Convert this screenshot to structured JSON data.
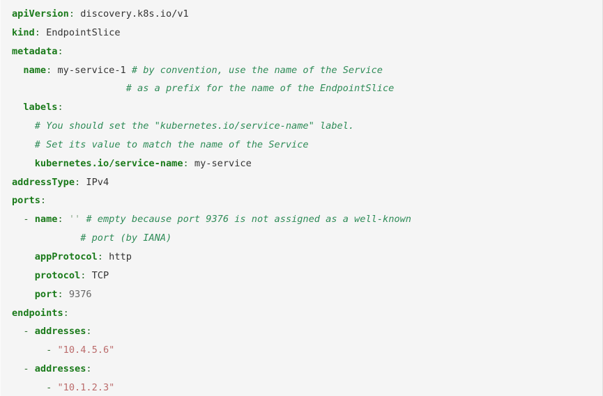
{
  "block": {
    "language": "yaml",
    "kind": "kubernetes-manifest",
    "background_color": "#f5f5f5",
    "border_color": "#e0e0e0",
    "colors": {
      "key": "#1a7a1a",
      "value": "#333333",
      "comment": "#2e8b57",
      "string": "#bb6b6b",
      "number": "#666666",
      "punctuation": "#2f6f2f"
    }
  },
  "code": {
    "lines": [
      {
        "id": "line-api-version",
        "indent": "",
        "tokens": [
          {
            "t": "k",
            "x": "apiVersion"
          },
          {
            "t": "p",
            "x": ":"
          },
          {
            "t": "v",
            "x": " discovery.k8s.io/v1"
          }
        ]
      },
      {
        "id": "line-kind",
        "indent": "",
        "tokens": [
          {
            "t": "k",
            "x": "kind"
          },
          {
            "t": "p",
            "x": ":"
          },
          {
            "t": "v",
            "x": " EndpointSlice"
          }
        ]
      },
      {
        "id": "line-metadata",
        "indent": "",
        "tokens": [
          {
            "t": "k",
            "x": "metadata"
          },
          {
            "t": "p",
            "x": ":"
          }
        ]
      },
      {
        "id": "line-metadata-name",
        "indent": "  ",
        "tokens": [
          {
            "t": "k",
            "x": "name"
          },
          {
            "t": "p",
            "x": ":"
          },
          {
            "t": "v",
            "x": " my-service-1 "
          },
          {
            "t": "c",
            "x": "# by convention, use the name of the Service"
          }
        ]
      },
      {
        "id": "line-metadata-name-comment-2",
        "indent": "                    ",
        "tokens": [
          {
            "t": "c",
            "x": "# as a prefix for the name of the EndpointSlice"
          }
        ]
      },
      {
        "id": "line-labels",
        "indent": "  ",
        "tokens": [
          {
            "t": "k",
            "x": "labels"
          },
          {
            "t": "p",
            "x": ":"
          }
        ]
      },
      {
        "id": "line-labels-comment-1",
        "indent": "    ",
        "tokens": [
          {
            "t": "c",
            "x": "# You should set the \"kubernetes.io/service-name\" label."
          }
        ]
      },
      {
        "id": "line-labels-comment-2",
        "indent": "    ",
        "tokens": [
          {
            "t": "c",
            "x": "# Set its value to match the name of the Service"
          }
        ]
      },
      {
        "id": "line-service-name-label",
        "indent": "    ",
        "tokens": [
          {
            "t": "k",
            "x": "kubernetes.io/service-name"
          },
          {
            "t": "p",
            "x": ":"
          },
          {
            "t": "v",
            "x": " my-service"
          }
        ]
      },
      {
        "id": "line-address-type",
        "indent": "",
        "tokens": [
          {
            "t": "k",
            "x": "addressType"
          },
          {
            "t": "p",
            "x": ":"
          },
          {
            "t": "v",
            "x": " IPv4"
          }
        ]
      },
      {
        "id": "line-ports",
        "indent": "",
        "tokens": [
          {
            "t": "k",
            "x": "ports"
          },
          {
            "t": "p",
            "x": ":"
          }
        ]
      },
      {
        "id": "line-port-name",
        "indent": "  ",
        "tokens": [
          {
            "t": "d",
            "x": "- "
          },
          {
            "t": "k",
            "x": "name"
          },
          {
            "t": "p",
            "x": ":"
          },
          {
            "t": "v",
            "x": " "
          },
          {
            "t": "se",
            "x": "''"
          },
          {
            "t": "v",
            "x": " "
          },
          {
            "t": "c",
            "x": "# empty because port 9376 is not assigned as a well-known"
          }
        ]
      },
      {
        "id": "line-port-name-comment-2",
        "indent": "            ",
        "tokens": [
          {
            "t": "c",
            "x": "# port (by IANA)"
          }
        ]
      },
      {
        "id": "line-app-protocol",
        "indent": "    ",
        "tokens": [
          {
            "t": "k",
            "x": "appProtocol"
          },
          {
            "t": "p",
            "x": ":"
          },
          {
            "t": "v",
            "x": " http"
          }
        ]
      },
      {
        "id": "line-protocol",
        "indent": "    ",
        "tokens": [
          {
            "t": "k",
            "x": "protocol"
          },
          {
            "t": "p",
            "x": ":"
          },
          {
            "t": "v",
            "x": " TCP"
          }
        ]
      },
      {
        "id": "line-port",
        "indent": "    ",
        "tokens": [
          {
            "t": "k",
            "x": "port"
          },
          {
            "t": "p",
            "x": ":"
          },
          {
            "t": "n",
            "x": " 9376"
          }
        ]
      },
      {
        "id": "line-endpoints",
        "indent": "",
        "tokens": [
          {
            "t": "k",
            "x": "endpoints"
          },
          {
            "t": "p",
            "x": ":"
          }
        ]
      },
      {
        "id": "line-endpoint-1-addresses",
        "indent": "  ",
        "tokens": [
          {
            "t": "d",
            "x": "- "
          },
          {
            "t": "k",
            "x": "addresses"
          },
          {
            "t": "p",
            "x": ":"
          }
        ]
      },
      {
        "id": "line-endpoint-1-address-value",
        "indent": "      ",
        "tokens": [
          {
            "t": "d",
            "x": "- "
          },
          {
            "t": "s",
            "x": "\"10.4.5.6\""
          }
        ]
      },
      {
        "id": "line-endpoint-2-addresses",
        "indent": "  ",
        "tokens": [
          {
            "t": "d",
            "x": "- "
          },
          {
            "t": "k",
            "x": "addresses"
          },
          {
            "t": "p",
            "x": ":"
          }
        ]
      },
      {
        "id": "line-endpoint-2-address-value",
        "indent": "      ",
        "tokens": [
          {
            "t": "d",
            "x": "- "
          },
          {
            "t": "s",
            "x": "\"10.1.2.3\""
          }
        ]
      }
    ]
  }
}
